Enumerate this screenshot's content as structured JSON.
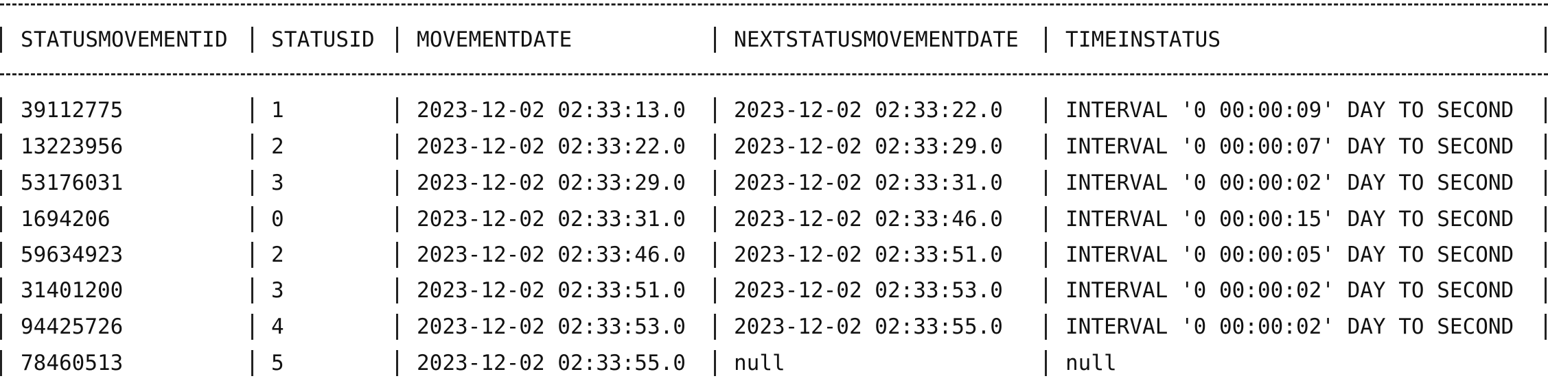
{
  "query_result": {
    "columns": [
      "STATUSMOVEMENTID",
      "STATUSID",
      "MOVEMENTDATE",
      "NEXTSTATUSMOVEMENTDATE",
      "TIMEINSTATUS"
    ],
    "rows": [
      [
        "39112775",
        "1",
        "2023-12-02 02:33:13.0",
        "2023-12-02 02:33:22.0",
        "INTERVAL '0 00:00:09' DAY TO SECOND"
      ],
      [
        "13223956",
        "2",
        "2023-12-02 02:33:22.0",
        "2023-12-02 02:33:29.0",
        "INTERVAL '0 00:00:07' DAY TO SECOND"
      ],
      [
        "53176031",
        "3",
        "2023-12-02 02:33:29.0",
        "2023-12-02 02:33:31.0",
        "INTERVAL '0 00:00:02' DAY TO SECOND"
      ],
      [
        "1694206",
        "0",
        "2023-12-02 02:33:31.0",
        "2023-12-02 02:33:46.0",
        "INTERVAL '0 00:00:15' DAY TO SECOND"
      ],
      [
        "59634923",
        "2",
        "2023-12-02 02:33:46.0",
        "2023-12-02 02:33:51.0",
        "INTERVAL '0 00:00:05' DAY TO SECOND"
      ],
      [
        "31401200",
        "3",
        "2023-12-02 02:33:51.0",
        "2023-12-02 02:33:53.0",
        "INTERVAL '0 00:00:02' DAY TO SECOND"
      ],
      [
        "94425726",
        "4",
        "2023-12-02 02:33:53.0",
        "2023-12-02 02:33:55.0",
        "INTERVAL '0 00:00:02' DAY TO SECOND"
      ],
      [
        "78460513",
        "5",
        "2023-12-02 02:33:55.0",
        "null",
        "null"
      ]
    ]
  }
}
